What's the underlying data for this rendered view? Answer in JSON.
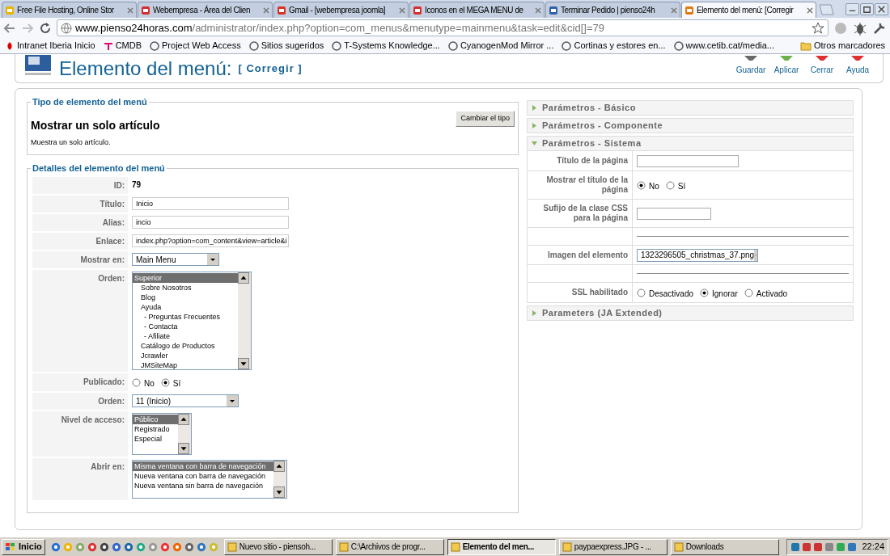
{
  "browser": {
    "tabs": [
      {
        "title": "Free File Hosting, Online Stor",
        "selected": false,
        "color": "#e8b400"
      },
      {
        "title": "Webempresa - Área del Clien",
        "selected": false,
        "color": "#d62c2c"
      },
      {
        "title": "Gmail - [webempresa joomla]",
        "selected": false,
        "color": "#d93025"
      },
      {
        "title": "Iconos en el MEGA MENU de",
        "selected": false,
        "color": "#d62c2c"
      },
      {
        "title": "Terminar Pedido | pienso24h",
        "selected": false,
        "color": "#2f5fa8"
      },
      {
        "title": "Elemento del menú: [Corregir",
        "selected": true,
        "color": "#e07a10"
      }
    ],
    "url_host": "www.pienso24horas.com",
    "url_path": "/administrator/index.php?option=com_menus&menutype=mainmenu&task=edit&cid[]=79",
    "bookmarks": [
      "Intranet Iberia Inicio",
      "CMDB",
      "Project Web Access",
      "Sitios sugeridos",
      "T-Systems Knowledge...",
      "CyanogenMod Mirror ...",
      "Cortinas y estores en...",
      "www.cetib.cat/media..."
    ],
    "other_bookmarks": "Otros marcadores"
  },
  "header": {
    "title": "Elemento del menú:",
    "subtitle": "[ Corregir ]",
    "buttons": [
      "Guardar",
      "Aplicar",
      "Cerrar",
      "Ayuda"
    ]
  },
  "type_panel": {
    "legend": "Tipo de elemento del menú",
    "title": "Mostrar un solo artículo",
    "description": "Muestra un solo artículo.",
    "button": "Cambiar el tipo"
  },
  "details": {
    "legend": "Detalles del elemento del menú",
    "rows": [
      {
        "label": "ID:",
        "kind": "text",
        "value": "79"
      },
      {
        "label": "Título:",
        "kind": "input",
        "value": "Inicio"
      },
      {
        "label": "Alias:",
        "kind": "input",
        "value": "incio"
      },
      {
        "label": "Enlace:",
        "kind": "input",
        "value": "index.php?option=com_content&view=article&i"
      },
      {
        "label": "Mostrar en:",
        "kind": "select",
        "value": "Main Menu"
      },
      {
        "label": "Orden:",
        "kind": "tree",
        "options": [
          {
            "label": "Superior",
            "selected": true,
            "children": [
              {
                "label": "Sobre Nosotros",
                "selected": false
              },
              {
                "label": "Blog",
                "selected": false
              },
              {
                "label": "Ayuda",
                "selected": false,
                "children": [
                  {
                    "label": "- Preguntas Frecuentes",
                    "selected": false
                  },
                  {
                    "label": "- Contacta",
                    "selected": false
                  },
                  {
                    "label": "- Afiliate",
                    "selected": false
                  }
                ]
              },
              {
                "label": "Catálogo de Productos",
                "selected": false
              },
              {
                "label": "Jcrawler",
                "selected": false
              },
              {
                "label": "JMSiteMap",
                "selected": false
              }
            ]
          }
        ]
      },
      {
        "label": "Publicado:",
        "kind": "radio",
        "options": [
          {
            "label": "No",
            "selected": false
          },
          {
            "label": "Sí",
            "selected": true
          }
        ]
      },
      {
        "label": "Orden:",
        "kind": "select",
        "value": "11 (Inicio)"
      },
      {
        "label": "Nivel de acceso:",
        "kind": "list",
        "options": [
          {
            "label": "Público",
            "selected": true
          },
          {
            "label": "Registrado",
            "selected": false
          },
          {
            "label": "Especial",
            "selected": false
          }
        ]
      },
      {
        "label": "Abrir en:",
        "kind": "list",
        "options": [
          {
            "label": "Misma ventana con barra de navegación",
            "selected": true
          },
          {
            "label": "Nueva ventana con barra de navegación",
            "selected": false
          },
          {
            "label": "Nueva ventana sin barra de navegación",
            "selected": false
          }
        ]
      }
    ]
  },
  "params": [
    {
      "title": "Parámetros - Básico",
      "expanded": false
    },
    {
      "title": "Parámetros - Componente",
      "expanded": false
    },
    {
      "title": "Parámetros - Sistema",
      "expanded": true,
      "rows": [
        {
          "label": "Título de la página",
          "kind": "input"
        },
        {
          "label": "Mostrar el título de la página",
          "kind": "radio",
          "options": [
            {
              "label": "No",
              "selected": true
            },
            {
              "label": "Sí",
              "selected": false
            }
          ]
        },
        {
          "label": "Sufijo de la clase CSS para la página",
          "kind": "input"
        },
        {
          "kind": "divider"
        },
        {
          "label": "Imagen del elemento",
          "kind": "select",
          "value": "1323296505_christmas_37.png"
        },
        {
          "kind": "divider"
        },
        {
          "label": "SSL habilitado",
          "kind": "radio",
          "options": [
            {
              "label": "Desactivado",
              "selected": false
            },
            {
              "label": "Ignorar",
              "selected": true
            },
            {
              "label": "Activado",
              "selected": false
            }
          ]
        }
      ]
    },
    {
      "title": "Parameters (JA Extended)",
      "expanded": false
    }
  ],
  "taskbar": {
    "start": "Inicio",
    "tasks": [
      {
        "title": "Nuevo sitio - piensoh...",
        "selected": false
      },
      {
        "title": "C:\\Archivos de progr...",
        "selected": false
      },
      {
        "title": "Elemento del men...",
        "selected": true
      },
      {
        "title": "paypaexpress.JPG - ...",
        "selected": false
      },
      {
        "title": "Downloads",
        "selected": false
      }
    ],
    "clock": "22:24"
  }
}
